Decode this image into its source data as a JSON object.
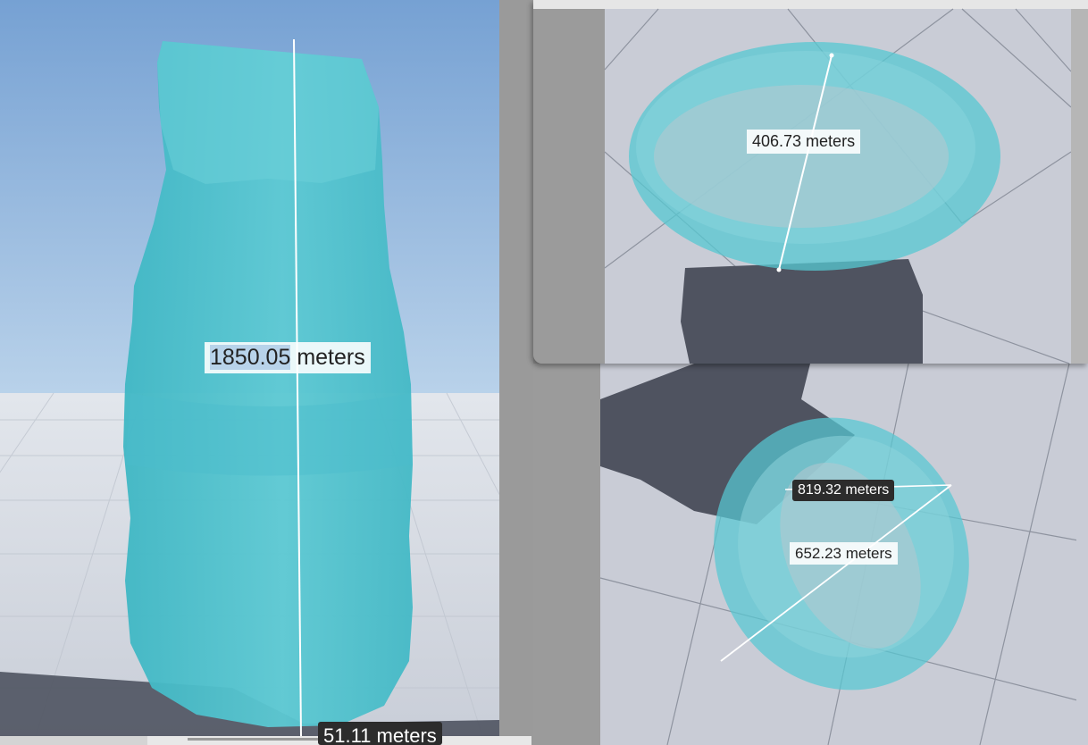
{
  "measurements": {
    "height": {
      "value": "1850.05",
      "unit": " meters"
    },
    "top_view": "406.73 meters",
    "bottom_view_upper": "819.32 meters",
    "bottom_view_lower": "652.23 meters",
    "partial_bottom": "51.11 meters"
  },
  "colors": {
    "sky_top": "#7aa5d4",
    "ground": "#d7dbe3",
    "model_fill": "#56c8d2",
    "model_stroke": "#2aa7b6",
    "shadow": "#4f5360"
  }
}
